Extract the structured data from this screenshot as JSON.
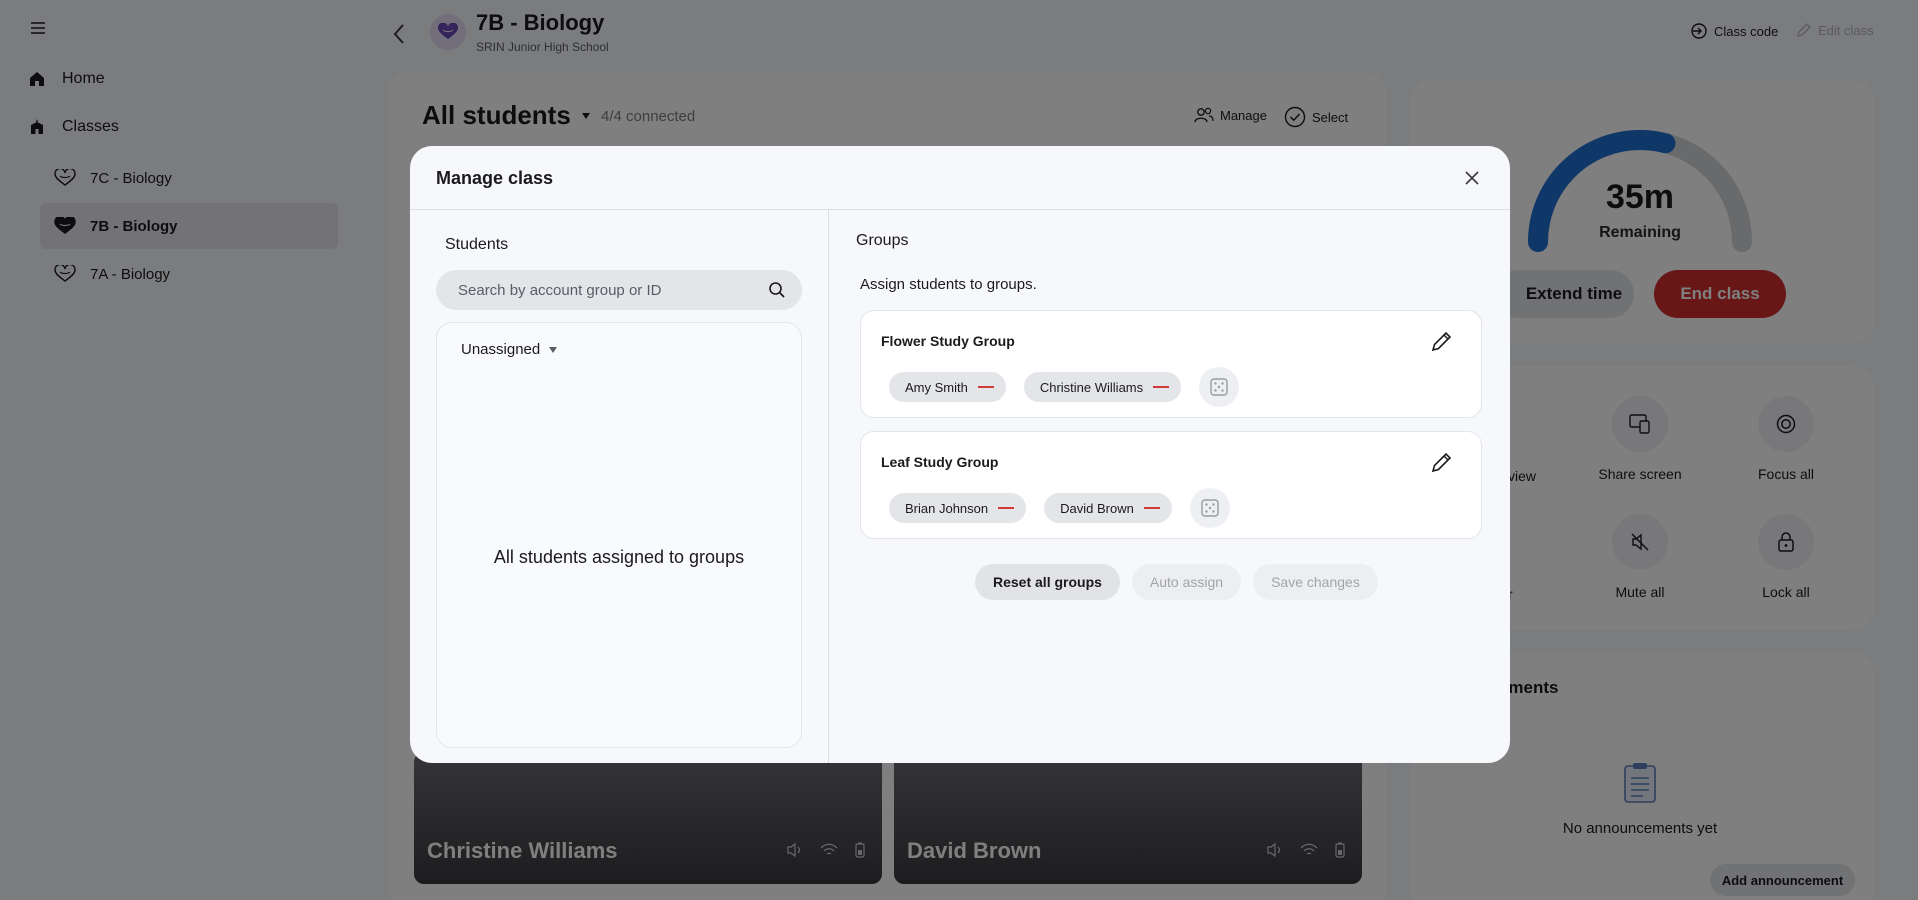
{
  "sidebar": {
    "home_label": "Home",
    "classes_label": "Classes",
    "classes": [
      {
        "label": "7C - Biology",
        "active": false
      },
      {
        "label": "7B - Biology",
        "active": true
      },
      {
        "label": "7A - Biology",
        "active": false
      }
    ]
  },
  "header": {
    "title": "7B - Biology",
    "school": "SRIN Junior High School",
    "class_code_label": "Class code",
    "edit_class_label": "Edit class"
  },
  "main": {
    "heading": "All students",
    "connected": "4/4 connected",
    "manage_label": "Manage",
    "select_label": "Select",
    "student_cards": [
      {
        "name": "Christine Williams"
      },
      {
        "name": "David Brown"
      }
    ]
  },
  "timer": {
    "value": "35m",
    "label": "Remaining",
    "progress_fraction": 0.58,
    "extend_label": "Extend time",
    "end_label": "End class"
  },
  "tools": {
    "partial_view_label": "view",
    "share_screen_label": "Share screen",
    "focus_all_label": "Focus all",
    "partial_r_label": "r",
    "mute_all_label": "Mute all",
    "lock_all_label": "Lock all"
  },
  "announcements": {
    "title_partial": "nments",
    "empty_text": "No announcements yet",
    "add_label": "Add announcement"
  },
  "modal": {
    "title": "Manage class",
    "students_title": "Students",
    "search_placeholder": "Search by account group or ID",
    "unassigned_label": "Unassigned",
    "unassigned_empty": "All students assigned to groups",
    "groups_title": "Groups",
    "assign_text": "Assign students to groups.",
    "groups": [
      {
        "name": "Flower Study Group",
        "members": [
          "Amy Smith",
          "Christine Williams"
        ]
      },
      {
        "name": "Leaf Study Group",
        "members": [
          "Brian Johnson",
          "David Brown"
        ]
      }
    ],
    "reset_label": "Reset all groups",
    "auto_assign_label": "Auto assign",
    "save_label": "Save changes"
  },
  "colors": {
    "accent_blue": "#1f6fd1",
    "end_red": "#d12c2c",
    "remove_red": "#d23a3a",
    "class_icon_purple": "#6b47b8"
  }
}
